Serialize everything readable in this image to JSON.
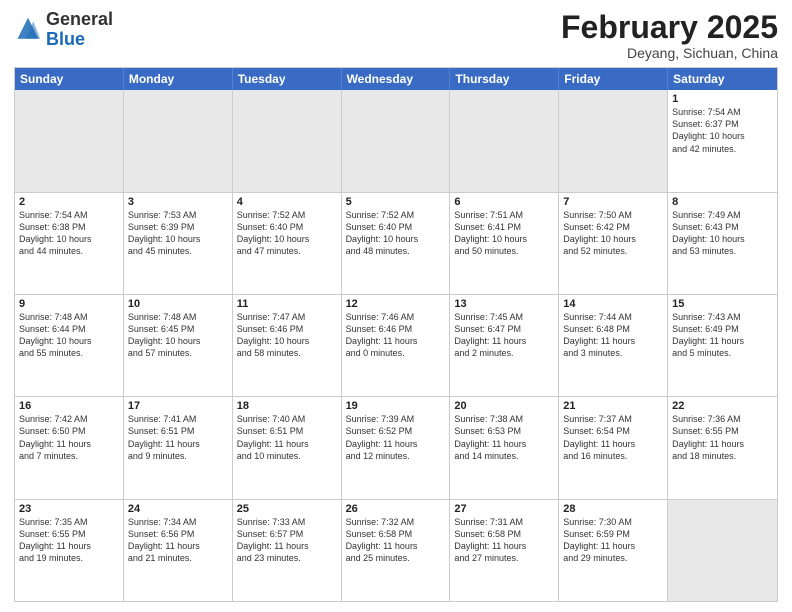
{
  "logo": {
    "general": "General",
    "blue": "Blue"
  },
  "title": "February 2025",
  "location": "Deyang, Sichuan, China",
  "days_of_week": [
    "Sunday",
    "Monday",
    "Tuesday",
    "Wednesday",
    "Thursday",
    "Friday",
    "Saturday"
  ],
  "weeks": [
    [
      {
        "day": "",
        "info": "",
        "shaded": true
      },
      {
        "day": "",
        "info": "",
        "shaded": true
      },
      {
        "day": "",
        "info": "",
        "shaded": true
      },
      {
        "day": "",
        "info": "",
        "shaded": true
      },
      {
        "day": "",
        "info": "",
        "shaded": true
      },
      {
        "day": "",
        "info": "",
        "shaded": true
      },
      {
        "day": "1",
        "info": "Sunrise: 7:54 AM\nSunset: 6:37 PM\nDaylight: 10 hours\nand 42 minutes."
      }
    ],
    [
      {
        "day": "2",
        "info": "Sunrise: 7:54 AM\nSunset: 6:38 PM\nDaylight: 10 hours\nand 44 minutes."
      },
      {
        "day": "3",
        "info": "Sunrise: 7:53 AM\nSunset: 6:39 PM\nDaylight: 10 hours\nand 45 minutes."
      },
      {
        "day": "4",
        "info": "Sunrise: 7:52 AM\nSunset: 6:40 PM\nDaylight: 10 hours\nand 47 minutes."
      },
      {
        "day": "5",
        "info": "Sunrise: 7:52 AM\nSunset: 6:40 PM\nDaylight: 10 hours\nand 48 minutes."
      },
      {
        "day": "6",
        "info": "Sunrise: 7:51 AM\nSunset: 6:41 PM\nDaylight: 10 hours\nand 50 minutes."
      },
      {
        "day": "7",
        "info": "Sunrise: 7:50 AM\nSunset: 6:42 PM\nDaylight: 10 hours\nand 52 minutes."
      },
      {
        "day": "8",
        "info": "Sunrise: 7:49 AM\nSunset: 6:43 PM\nDaylight: 10 hours\nand 53 minutes."
      }
    ],
    [
      {
        "day": "9",
        "info": "Sunrise: 7:48 AM\nSunset: 6:44 PM\nDaylight: 10 hours\nand 55 minutes."
      },
      {
        "day": "10",
        "info": "Sunrise: 7:48 AM\nSunset: 6:45 PM\nDaylight: 10 hours\nand 57 minutes."
      },
      {
        "day": "11",
        "info": "Sunrise: 7:47 AM\nSunset: 6:46 PM\nDaylight: 10 hours\nand 58 minutes."
      },
      {
        "day": "12",
        "info": "Sunrise: 7:46 AM\nSunset: 6:46 PM\nDaylight: 11 hours\nand 0 minutes."
      },
      {
        "day": "13",
        "info": "Sunrise: 7:45 AM\nSunset: 6:47 PM\nDaylight: 11 hours\nand 2 minutes."
      },
      {
        "day": "14",
        "info": "Sunrise: 7:44 AM\nSunset: 6:48 PM\nDaylight: 11 hours\nand 3 minutes."
      },
      {
        "day": "15",
        "info": "Sunrise: 7:43 AM\nSunset: 6:49 PM\nDaylight: 11 hours\nand 5 minutes."
      }
    ],
    [
      {
        "day": "16",
        "info": "Sunrise: 7:42 AM\nSunset: 6:50 PM\nDaylight: 11 hours\nand 7 minutes."
      },
      {
        "day": "17",
        "info": "Sunrise: 7:41 AM\nSunset: 6:51 PM\nDaylight: 11 hours\nand 9 minutes."
      },
      {
        "day": "18",
        "info": "Sunrise: 7:40 AM\nSunset: 6:51 PM\nDaylight: 11 hours\nand 10 minutes."
      },
      {
        "day": "19",
        "info": "Sunrise: 7:39 AM\nSunset: 6:52 PM\nDaylight: 11 hours\nand 12 minutes."
      },
      {
        "day": "20",
        "info": "Sunrise: 7:38 AM\nSunset: 6:53 PM\nDaylight: 11 hours\nand 14 minutes."
      },
      {
        "day": "21",
        "info": "Sunrise: 7:37 AM\nSunset: 6:54 PM\nDaylight: 11 hours\nand 16 minutes."
      },
      {
        "day": "22",
        "info": "Sunrise: 7:36 AM\nSunset: 6:55 PM\nDaylight: 11 hours\nand 18 minutes."
      }
    ],
    [
      {
        "day": "23",
        "info": "Sunrise: 7:35 AM\nSunset: 6:55 PM\nDaylight: 11 hours\nand 19 minutes."
      },
      {
        "day": "24",
        "info": "Sunrise: 7:34 AM\nSunset: 6:56 PM\nDaylight: 11 hours\nand 21 minutes."
      },
      {
        "day": "25",
        "info": "Sunrise: 7:33 AM\nSunset: 6:57 PM\nDaylight: 11 hours\nand 23 minutes."
      },
      {
        "day": "26",
        "info": "Sunrise: 7:32 AM\nSunset: 6:58 PM\nDaylight: 11 hours\nand 25 minutes."
      },
      {
        "day": "27",
        "info": "Sunrise: 7:31 AM\nSunset: 6:58 PM\nDaylight: 11 hours\nand 27 minutes."
      },
      {
        "day": "28",
        "info": "Sunrise: 7:30 AM\nSunset: 6:59 PM\nDaylight: 11 hours\nand 29 minutes."
      },
      {
        "day": "",
        "info": "",
        "shaded": true
      }
    ]
  ]
}
